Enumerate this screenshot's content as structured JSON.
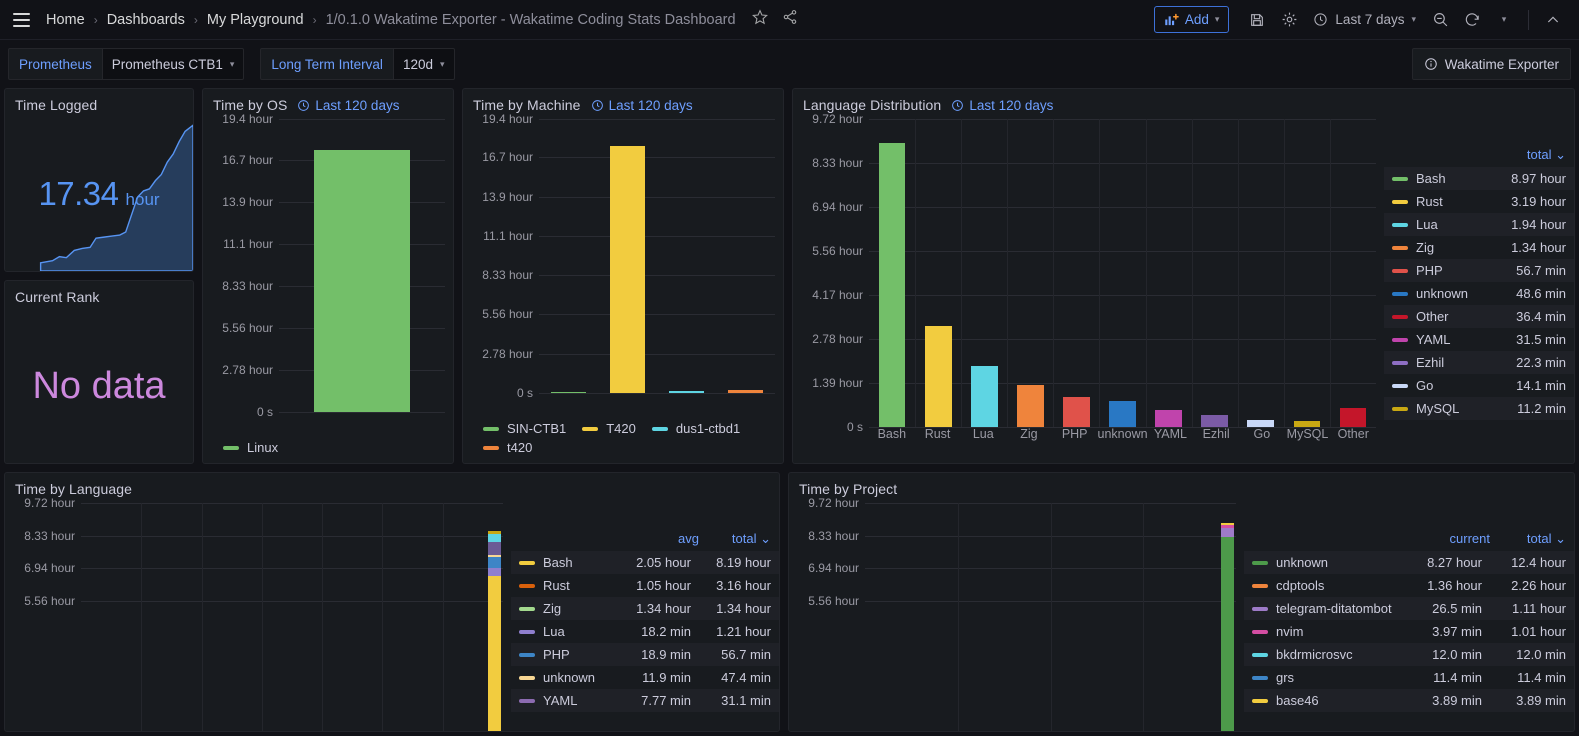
{
  "nav": {
    "menu_icon": "hamburger-icon",
    "breadcrumbs": [
      "Home",
      "Dashboards",
      "My Playground",
      "1/0.1.0 Wakatime Exporter - Wakatime Coding Stats Dashboard"
    ],
    "star_icon": "star-icon",
    "share_icon": "share-icon",
    "add_label": "Add",
    "add_icon": "add-panel-icon",
    "save_icon": "save-icon",
    "settings_icon": "gear-icon",
    "time_range": "Last 7 days",
    "clock_icon": "clock-icon",
    "zoom_out_icon": "zoom-out-icon",
    "refresh_icon": "refresh-icon",
    "collapse_icon": "chevron-up-icon"
  },
  "variables": {
    "datasource": {
      "label": "Prometheus",
      "value": "Prometheus CTB1"
    },
    "interval": {
      "label": "Long Term Interval",
      "value": "120d"
    },
    "link_button": {
      "label": "Wakatime Exporter",
      "icon": "info-circle-icon"
    }
  },
  "panels": {
    "time_logged": {
      "title": "Time Logged",
      "value": "17.34",
      "unit": "hour",
      "color": "#5794f2"
    },
    "current_rank": {
      "title": "Current Rank",
      "value": "No data",
      "color": "#cc88dd"
    },
    "time_by_os": {
      "title": "Time by OS",
      "timetag": "Last 120 days",
      "legend": [
        {
          "label": "Linux",
          "color": "#73bf69"
        }
      ]
    },
    "time_by_machine": {
      "title": "Time by Machine",
      "timetag": "Last 120 days",
      "legend": [
        {
          "label": "SIN-CTB1",
          "color": "#73bf69"
        },
        {
          "label": "T420",
          "color": "#f2cc3f"
        },
        {
          "label": "dus1-ctbd1",
          "color": "#5ed5e3"
        },
        {
          "label": "t420",
          "color": "#ef843c"
        }
      ]
    },
    "language_distribution": {
      "title": "Language Distribution",
      "timetag": "Last 120 days",
      "legend_header": "total",
      "legend_sort_icon": "chevron-down-icon"
    },
    "time_by_language": {
      "title": "Time by Language",
      "legend_headers": [
        "avg",
        "total"
      ],
      "legend_sort_icon": "chevron-down-icon",
      "rows": [
        {
          "name": "Bash",
          "avg": "2.05 hour",
          "total": "8.19 hour",
          "color": "#f2cc3f"
        },
        {
          "name": "Rust",
          "avg": "1.05 hour",
          "total": "3.16 hour",
          "color": "#d9600b"
        },
        {
          "name": "Zig",
          "avg": "1.34 hour",
          "total": "1.34 hour",
          "color": "#a3d98e"
        },
        {
          "name": "Lua",
          "avg": "18.2 min",
          "total": "1.21 hour",
          "color": "#8f7fce"
        },
        {
          "name": "PHP",
          "avg": "18.9 min",
          "total": "56.7 min",
          "color": "#3d85c6"
        },
        {
          "name": "unknown",
          "avg": "11.9 min",
          "total": "47.4 min",
          "color": "#f7d794"
        },
        {
          "name": "YAML",
          "avg": "7.77 min",
          "total": "31.1 min",
          "color": "#8c6bb1"
        }
      ]
    },
    "time_by_project": {
      "title": "Time by Project",
      "legend_headers": [
        "current",
        "total"
      ],
      "legend_sort_icon": "chevron-down-icon",
      "rows": [
        {
          "name": "unknown",
          "current": "8.27 hour",
          "total": "12.4 hour",
          "color": "#4d9a4a"
        },
        {
          "name": "cdptools",
          "current": "1.36 hour",
          "total": "2.26 hour",
          "color": "#ef843c"
        },
        {
          "name": "telegram-ditatombot",
          "current": "26.5 min",
          "total": "1.11 hour",
          "color": "#9e7bc8"
        },
        {
          "name": "nvim",
          "current": "3.97 min",
          "total": "1.01 hour",
          "color": "#d44ea3"
        },
        {
          "name": "bkdrmicrosvc",
          "current": "12.0 min",
          "total": "12.0 min",
          "color": "#5ed5e3"
        },
        {
          "name": "grs",
          "current": "11.4 min",
          "total": "11.4 min",
          "color": "#3d85c6"
        },
        {
          "name": "base46",
          "current": "3.89 min",
          "total": "3.89 min",
          "color": "#f2cc3f"
        }
      ]
    }
  },
  "chart_data": [
    {
      "id": "time_by_os",
      "type": "bar",
      "title": "Time by OS",
      "categories": [
        "Linux"
      ],
      "values": [
        17.34
      ],
      "colors": [
        "#73bf69"
      ],
      "ylabel": "",
      "ytick_labels": [
        "19.4 hour",
        "16.7 hour",
        "13.9 hour",
        "11.1 hour",
        "8.33 hour",
        "5.56 hour",
        "2.78 hour",
        "0 s"
      ],
      "ytick_values": [
        19.4,
        16.7,
        13.9,
        11.1,
        8.33,
        5.56,
        2.78,
        0
      ],
      "ylim": [
        0,
        19.4
      ],
      "grid": true,
      "legend_position": "bottom"
    },
    {
      "id": "time_by_machine",
      "type": "bar",
      "title": "Time by Machine",
      "categories": [
        "SIN-CTB1",
        "T420",
        "dus1-ctbd1",
        "t420"
      ],
      "values": [
        0.08,
        17.5,
        0.15,
        0.2
      ],
      "colors": [
        "#73bf69",
        "#f2cc3f",
        "#5ed5e3",
        "#ef843c"
      ],
      "ytick_labels": [
        "19.4 hour",
        "16.7 hour",
        "13.9 hour",
        "11.1 hour",
        "8.33 hour",
        "5.56 hour",
        "2.78 hour",
        "0 s"
      ],
      "ytick_values": [
        19.4,
        16.7,
        13.9,
        11.1,
        8.33,
        5.56,
        2.78,
        0
      ],
      "ylim": [
        0,
        19.4
      ],
      "grid": true,
      "legend_position": "bottom"
    },
    {
      "id": "language_distribution",
      "type": "bar",
      "title": "Language Distribution",
      "categories": [
        "Bash",
        "Rust",
        "Lua",
        "Zig",
        "PHP",
        "unknown",
        "YAML",
        "Ezhil",
        "Go",
        "MySQL",
        "Other"
      ],
      "values": [
        8.97,
        3.19,
        1.94,
        1.34,
        0.945,
        0.81,
        0.525,
        0.372,
        0.235,
        0.187,
        0.607
      ],
      "value_labels": [
        "8.97 hour",
        "3.19 hour",
        "1.94 hour",
        "1.34 hour",
        "56.7 min",
        "48.6 min",
        "31.5 min",
        "22.3 min",
        "14.1 min",
        "11.2 min",
        "36.4 min"
      ],
      "colors": [
        "#73bf69",
        "#f2cc3f",
        "#5ed5e3",
        "#ef843c",
        "#e0524a",
        "#2978c4",
        "#c044ac",
        "#7b5ba6",
        "#c9d8f7",
        "#c9a813",
        "#c4162a"
      ],
      "ytick_labels": [
        "9.72 hour",
        "8.33 hour",
        "6.94 hour",
        "5.56 hour",
        "4.17 hour",
        "2.78 hour",
        "1.39 hour",
        "0 s"
      ],
      "ytick_values": [
        9.72,
        8.33,
        6.94,
        5.56,
        4.17,
        2.78,
        1.39,
        0
      ],
      "ylim": [
        0,
        9.72
      ],
      "grid": true,
      "legend_position": "right",
      "legend_rows": [
        {
          "name": "Bash",
          "total": "8.97 hour",
          "color": "#73bf69"
        },
        {
          "name": "Rust",
          "total": "3.19 hour",
          "color": "#f2cc3f"
        },
        {
          "name": "Lua",
          "total": "1.94 hour",
          "color": "#5ed5e3"
        },
        {
          "name": "Zig",
          "total": "1.34 hour",
          "color": "#ef843c"
        },
        {
          "name": "PHP",
          "total": "56.7 min",
          "color": "#e0524a"
        },
        {
          "name": "unknown",
          "total": "48.6 min",
          "color": "#2978c4"
        },
        {
          "name": "Other",
          "total": "36.4 min",
          "color": "#c4162a"
        },
        {
          "name": "YAML",
          "total": "31.5 min",
          "color": "#c044ac"
        },
        {
          "name": "Ezhil",
          "total": "22.3 min",
          "color": "#8f6fc4"
        },
        {
          "name": "Go",
          "total": "14.1 min",
          "color": "#c9d8f7"
        },
        {
          "name": "MySQL",
          "total": "11.2 min",
          "color": "#c9a813"
        }
      ]
    },
    {
      "id": "time_by_language",
      "type": "bar",
      "title": "Time by Language",
      "stacked": true,
      "ytick_labels": [
        "9.72 hour",
        "8.33 hour",
        "6.94 hour",
        "5.56 hour"
      ],
      "ytick_values": [
        9.72,
        8.33,
        6.94,
        5.56
      ],
      "ylim": [
        0,
        9.72
      ],
      "grid": true,
      "legend_position": "right",
      "stack_segments": [
        {
          "name": "Bash",
          "value": 6.6,
          "color": "#f2cc3f"
        },
        {
          "name": "Lua",
          "value": 0.33,
          "color": "#8f7fce"
        },
        {
          "name": "PHP",
          "value": 0.5,
          "color": "#3d85c6"
        },
        {
          "name": "unknown",
          "value": 0.09,
          "color": "#f7d794"
        },
        {
          "name": "YAML",
          "value": 0.55,
          "color": "#6b5b95"
        },
        {
          "name": "Zig",
          "value": 0.35,
          "color": "#5ed5e3"
        },
        {
          "name": "Rust",
          "value": 0.1,
          "color": "#c9a813"
        }
      ]
    },
    {
      "id": "time_by_project",
      "type": "bar",
      "title": "Time by Project",
      "stacked": true,
      "ytick_labels": [
        "9.72 hour",
        "8.33 hour",
        "6.94 hour",
        "5.56 hour"
      ],
      "ytick_values": [
        9.72,
        8.33,
        6.94,
        5.56
      ],
      "ylim": [
        0,
        9.72
      ],
      "grid": true,
      "legend_position": "right",
      "stack_segments": [
        {
          "name": "unknown",
          "value": 8.27,
          "color": "#4d9a4a"
        },
        {
          "name": "telegram-ditatombot",
          "value": 0.4,
          "color": "#9e7bc8"
        },
        {
          "name": "nvim",
          "value": 0.1,
          "color": "#d44ea3"
        },
        {
          "name": "base46",
          "value": 0.08,
          "color": "#f2cc3f"
        }
      ]
    }
  ]
}
